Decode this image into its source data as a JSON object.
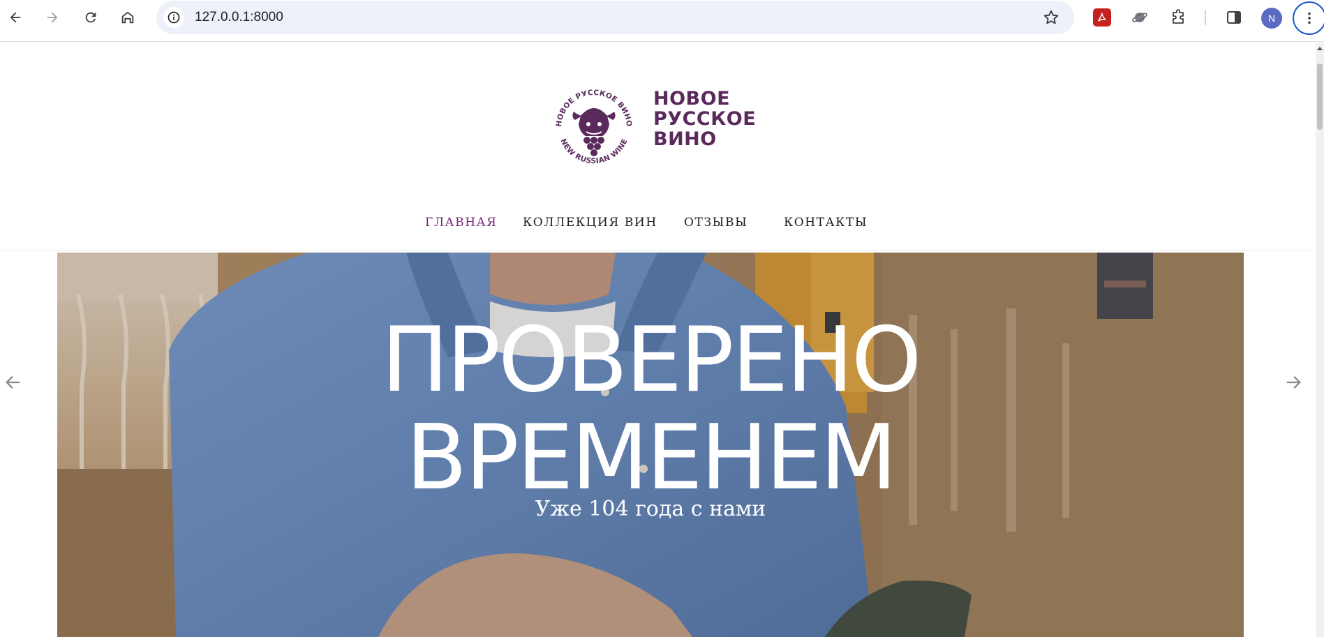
{
  "browser": {
    "url": "127.0.0.1:8000",
    "profile_initial": "N",
    "icons": [
      "back-icon",
      "forward-icon",
      "reload-icon",
      "home-icon",
      "site-info-icon",
      "bookmark-star-icon",
      "pdf-extension-icon",
      "planet-extension-icon",
      "puzzle-extensions-icon",
      "side-panel-icon",
      "kebab-menu-icon"
    ]
  },
  "site": {
    "logo_text_lines": [
      "НОВОЕ",
      "РУССКОЕ",
      "ВИНО"
    ],
    "logo_ring_text_top": "НОВОЕ РУССКОЕ ВИНО",
    "logo_ring_text_bottom": "NEW RUSSIAN WINE",
    "brand_color": "#5a2a5c"
  },
  "nav": {
    "items": [
      {
        "label": "ГЛАВНАЯ",
        "active": true
      },
      {
        "label": "КОЛЛЕКЦИЯ ВИН",
        "active": false
      },
      {
        "label": "ОТЗЫВЫ",
        "active": false
      },
      {
        "label": "КОНТАКТЫ",
        "active": false
      }
    ],
    "active_color": "#7a2877"
  },
  "hero": {
    "title_line1": "ПРОВЕРЕНО",
    "title_line2": "ВРЕМЕНЕМ",
    "subtitle": "Уже 104 года с нами",
    "prev_icon": "arrow-left-icon",
    "next_icon": "arrow-right-icon"
  }
}
